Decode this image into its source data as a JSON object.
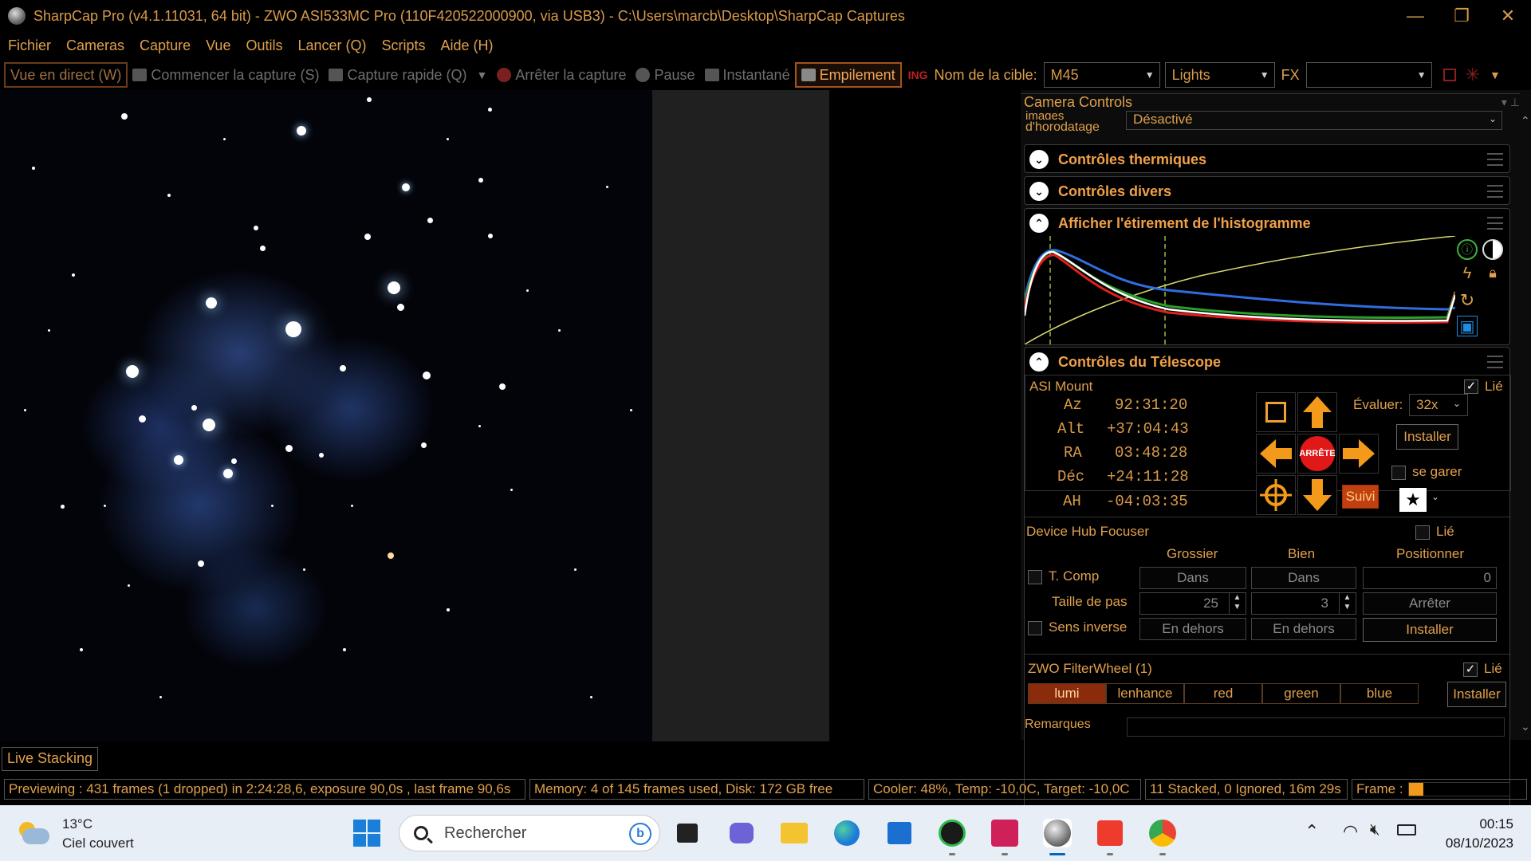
{
  "window": {
    "title": "SharpCap Pro (v4.1.11031, 64 bit) - ZWO ASI533MC Pro (110F420522000900, via USB3) - C:\\Users\\marcb\\Desktop\\SharpCap Captures",
    "minimize": "—",
    "restore": "❐",
    "close": "✕"
  },
  "menu": [
    "Fichier",
    "Cameras",
    "Capture",
    "Vue",
    "Outils",
    "Lancer (Q)",
    "Scripts",
    "Aide (H)"
  ],
  "toolbar": {
    "live_view": "Vue en direct (W)",
    "start_capture": "Commencer la capture (S)",
    "quick_capture": "Capture rapide (Q)",
    "stop_capture": "Arrêter la capture",
    "pause": "Pause",
    "snapshot": "Instantané",
    "stacking": "Empilement",
    "ing_icon": "ING",
    "target_label": "Nom de la cible:",
    "target_value": "M45",
    "frame_type": "Lights",
    "fx_label": "FX",
    "fx_value": ""
  },
  "panel": {
    "header": "Camera Controls",
    "timestamp": {
      "label_line1": "images",
      "label_line2": "d'horodatage",
      "value": "Désactivé"
    },
    "sections": {
      "thermal": "Contrôles thermiques",
      "misc": "Contrôles divers",
      "histogram": "Afficher l'étirement de l'histogramme",
      "telescope": "Contrôles du Télescope"
    },
    "mount": {
      "name": "ASI Mount",
      "linked_label": "Lié",
      "linked": true,
      "coords": [
        {
          "label": "Az",
          "value": "92:31:20"
        },
        {
          "label": "Alt",
          "value": "+37:04:43"
        },
        {
          "label": "RA",
          "value": "03:48:28"
        },
        {
          "label": "Déc",
          "value": "+24:11:28"
        },
        {
          "label": "AH",
          "value": "-04:03:35"
        }
      ],
      "rate_label": "Évaluer:",
      "rate_value": "32x",
      "install": "Installer",
      "park_label": "se garer",
      "stop": "ARRÊTE",
      "tracking": "Suivi"
    },
    "focuser": {
      "name": "Device Hub Focuser",
      "linked_label": "Lié",
      "col_coarse": "Grossier",
      "col_fine": "Bien",
      "col_position": "Positionner",
      "tcomp": "T. Comp",
      "in_coarse": "Dans",
      "in_fine": "Dans",
      "position_value": "0",
      "step_label": "Taille de pas",
      "step_coarse": "25",
      "step_fine": "3",
      "stop": "Arrêter",
      "reverse": "Sens inverse",
      "out_coarse": "En dehors",
      "out_fine": "En dehors",
      "install": "Installer"
    },
    "filterwheel": {
      "name": "ZWO FilterWheel (1)",
      "linked_label": "Lié",
      "filters": [
        "lumi",
        "lenhance",
        "red",
        "green",
        "blue"
      ],
      "install": "Installer"
    },
    "notes_label": "Remarques"
  },
  "live_stacking_tab": "Live Stacking",
  "status": {
    "preview": "Previewing : 431 frames (1 dropped) in 2:24:28,6, exposure 90,0s , last frame 90,6s",
    "memory": "Memory: 4 of 145 frames used, Disk: 172 GB free",
    "cooler": "Cooler: 48%, Temp: -10,0C, Target: -10,0C",
    "stacked": "11 Stacked, 0 Ignored, 16m 29s",
    "frame_label": "Frame :"
  },
  "taskbar": {
    "temp": "13°C",
    "weather": "Ciel couvert",
    "search_placeholder": "Rechercher",
    "time": "00:15",
    "date": "08/10/2023"
  },
  "colors": {
    "accent": "#e0a04c",
    "stop_red": "#e02020",
    "filter_selected": "#8a2c0c",
    "taskbar": "#e8eef6"
  }
}
